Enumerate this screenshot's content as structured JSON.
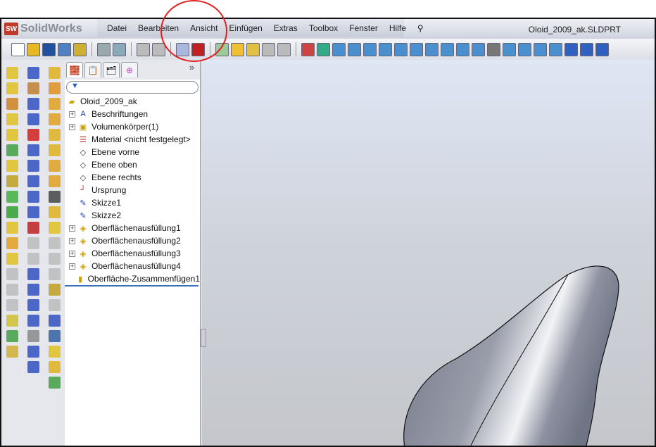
{
  "app": {
    "name": "SolidWorks",
    "logo_text": "SW",
    "document_title": "Oloid_2009_ak.SLDPRT"
  },
  "menu": [
    "Datei",
    "Bearbeiten",
    "Ansicht",
    "Einfügen",
    "Extras",
    "Toolbox",
    "Fenster",
    "Hilfe"
  ],
  "tree": {
    "filter_icon": "funnel-icon",
    "more": "»",
    "root": "Oloid_2009_ak",
    "items": [
      {
        "label": "Beschriftungen",
        "expandable": true,
        "icon": "annotations-icon"
      },
      {
        "label": "Volumenkörper(1)",
        "expandable": true,
        "icon": "solid-bodies-icon"
      },
      {
        "label": "Material <nicht festgelegt>",
        "expandable": false,
        "icon": "material-icon"
      },
      {
        "label": "Ebene vorne",
        "expandable": false,
        "icon": "plane-icon"
      },
      {
        "label": "Ebene oben",
        "expandable": false,
        "icon": "plane-icon"
      },
      {
        "label": "Ebene rechts",
        "expandable": false,
        "icon": "plane-icon"
      },
      {
        "label": "Ursprung",
        "expandable": false,
        "icon": "origin-icon"
      },
      {
        "label": "Skizze1",
        "expandable": false,
        "icon": "sketch-icon"
      },
      {
        "label": "Skizze2",
        "expandable": false,
        "icon": "sketch-icon"
      },
      {
        "label": "Oberflächenausfüllung1",
        "expandable": true,
        "icon": "surface-fill-icon"
      },
      {
        "label": "Oberflächenausfüllung2",
        "expandable": true,
        "icon": "surface-fill-icon"
      },
      {
        "label": "Oberflächenausfüllung3",
        "expandable": true,
        "icon": "surface-fill-icon"
      },
      {
        "label": "Oberflächenausfüllung4",
        "expandable": true,
        "icon": "surface-fill-icon"
      },
      {
        "label": "Oberfläche-Zusammenfügen1",
        "expandable": false,
        "icon": "surface-knit-icon"
      }
    ]
  },
  "colors": {
    "accent": "#3a6fc0",
    "annotation": "#e02020"
  }
}
